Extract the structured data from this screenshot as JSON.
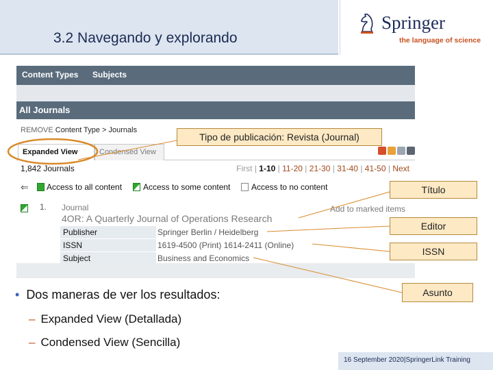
{
  "slide": {
    "title": "3.2 Navegando y explorando",
    "logo_name": "Springer",
    "logo_tagline": "the language of science",
    "footer_date": "16 September 2020",
    "footer_separator": "|",
    "footer_text": "SpringerLink Training"
  },
  "app": {
    "tabs": [
      "Content Types",
      "Subjects"
    ],
    "section_title": "All Journals",
    "breadcrumb_remove": "REMOVE",
    "breadcrumb_path": "Content Type > Journals",
    "view_tabs": {
      "expanded": "Expanded View",
      "condensed": "Condensed View"
    },
    "result_count": "1,842 Journals",
    "pager": {
      "first": "First",
      "pages": [
        "1-10",
        "11-20",
        "21-30",
        "31-40",
        "41-50"
      ],
      "next": "Next",
      "separator": "|"
    },
    "legend": {
      "all": "Access to all content",
      "some": "Access to some content",
      "none": "Access to no content"
    },
    "result": {
      "number": "1.",
      "type": "Journal",
      "add_to_marked": "Add to marked items",
      "title": "4OR: A Quarterly Journal of Operations Research",
      "fields": [
        {
          "key": "Publisher",
          "value": "Springer Berlin / Heidelberg"
        },
        {
          "key": "ISSN",
          "value": "1619-4500 (Print) 1614-2411 (Online)"
        },
        {
          "key": "Subject",
          "value": "Business and Economics"
        }
      ]
    },
    "colors": {
      "header_bar": "#5a6c7c",
      "access_green": "#2fa82f",
      "callout_fill": "#fde9c4",
      "highlight_ring": "#d98a2b"
    }
  },
  "callouts": {
    "pub_type": "Tipo de publicación: Revista (Journal)",
    "titulo": "Título",
    "editor": "Editor",
    "issn": "ISSN",
    "asunto": "Asunto"
  },
  "bullets": {
    "main": "Dos maneras de ver los resultados:",
    "sub": [
      "Expanded View (Detallada)",
      "Condensed View (Sencilla)"
    ]
  }
}
